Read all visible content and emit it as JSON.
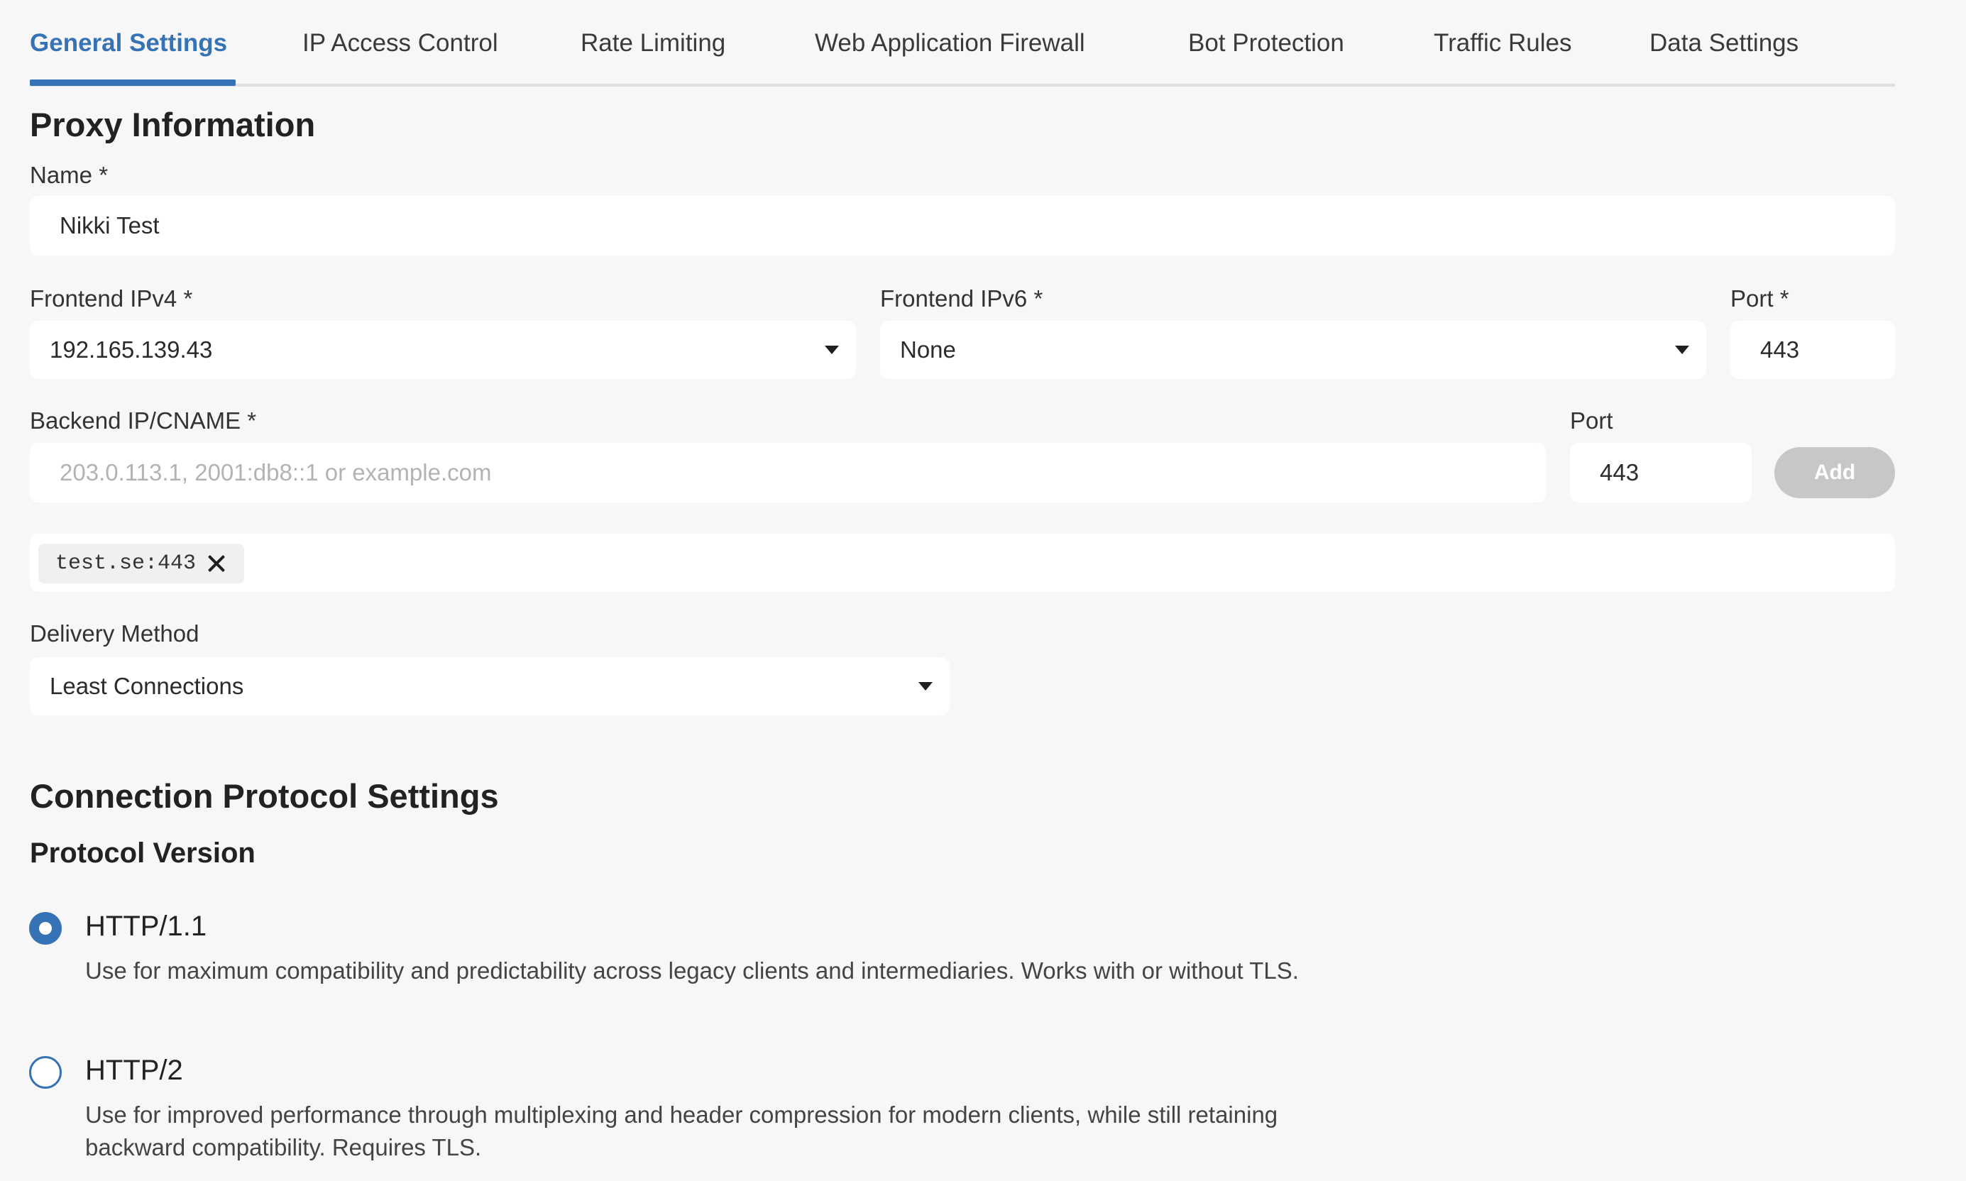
{
  "tabs": [
    {
      "label": "General Settings",
      "active": true
    },
    {
      "label": "IP Access Control",
      "active": false
    },
    {
      "label": "Rate Limiting",
      "active": false
    },
    {
      "label": "Web Application Firewall",
      "active": false
    },
    {
      "label": "Bot Protection",
      "active": false
    },
    {
      "label": "Traffic Rules",
      "active": false
    },
    {
      "label": "Data Settings",
      "active": false
    }
  ],
  "proxy_info": {
    "heading": "Proxy Information",
    "name_label": "Name *",
    "name_value": "Nikki Test",
    "frontend_ipv4_label": "Frontend IPv4 *",
    "frontend_ipv4_value": "192.165.139.43",
    "frontend_ipv6_label": "Frontend IPv6 *",
    "frontend_ipv6_value": "None",
    "frontend_port_label": "Port *",
    "frontend_port_value": "443",
    "backend_label": "Backend IP/CNAME *",
    "backend_value": "",
    "backend_placeholder": "203.0.113.1, 2001:db8::1 or example.com",
    "backend_port_label": "Port",
    "backend_port_value": "443",
    "add_label": "Add",
    "backend_tags": [
      "test.se:443"
    ],
    "delivery_label": "Delivery Method",
    "delivery_value": "Least Connections"
  },
  "connection_protocol": {
    "heading": "Connection Protocol Settings",
    "subheading": "Protocol Version",
    "options": [
      {
        "label": "HTTP/1.1",
        "selected": true,
        "description": "Use for maximum compatibility and predictability across legacy clients and intermediaries. Works with or without TLS."
      },
      {
        "label": "HTTP/2",
        "selected": false,
        "description": "Use for improved performance through multiplexing and header compression for modern clients, while still retaining backward compatibility. Requires TLS."
      }
    ]
  },
  "colors": {
    "accent": "#3673b6",
    "background": "#f7f7f7",
    "field_background": "#ffffff",
    "add_button_disabled": "#c7c7c7"
  }
}
